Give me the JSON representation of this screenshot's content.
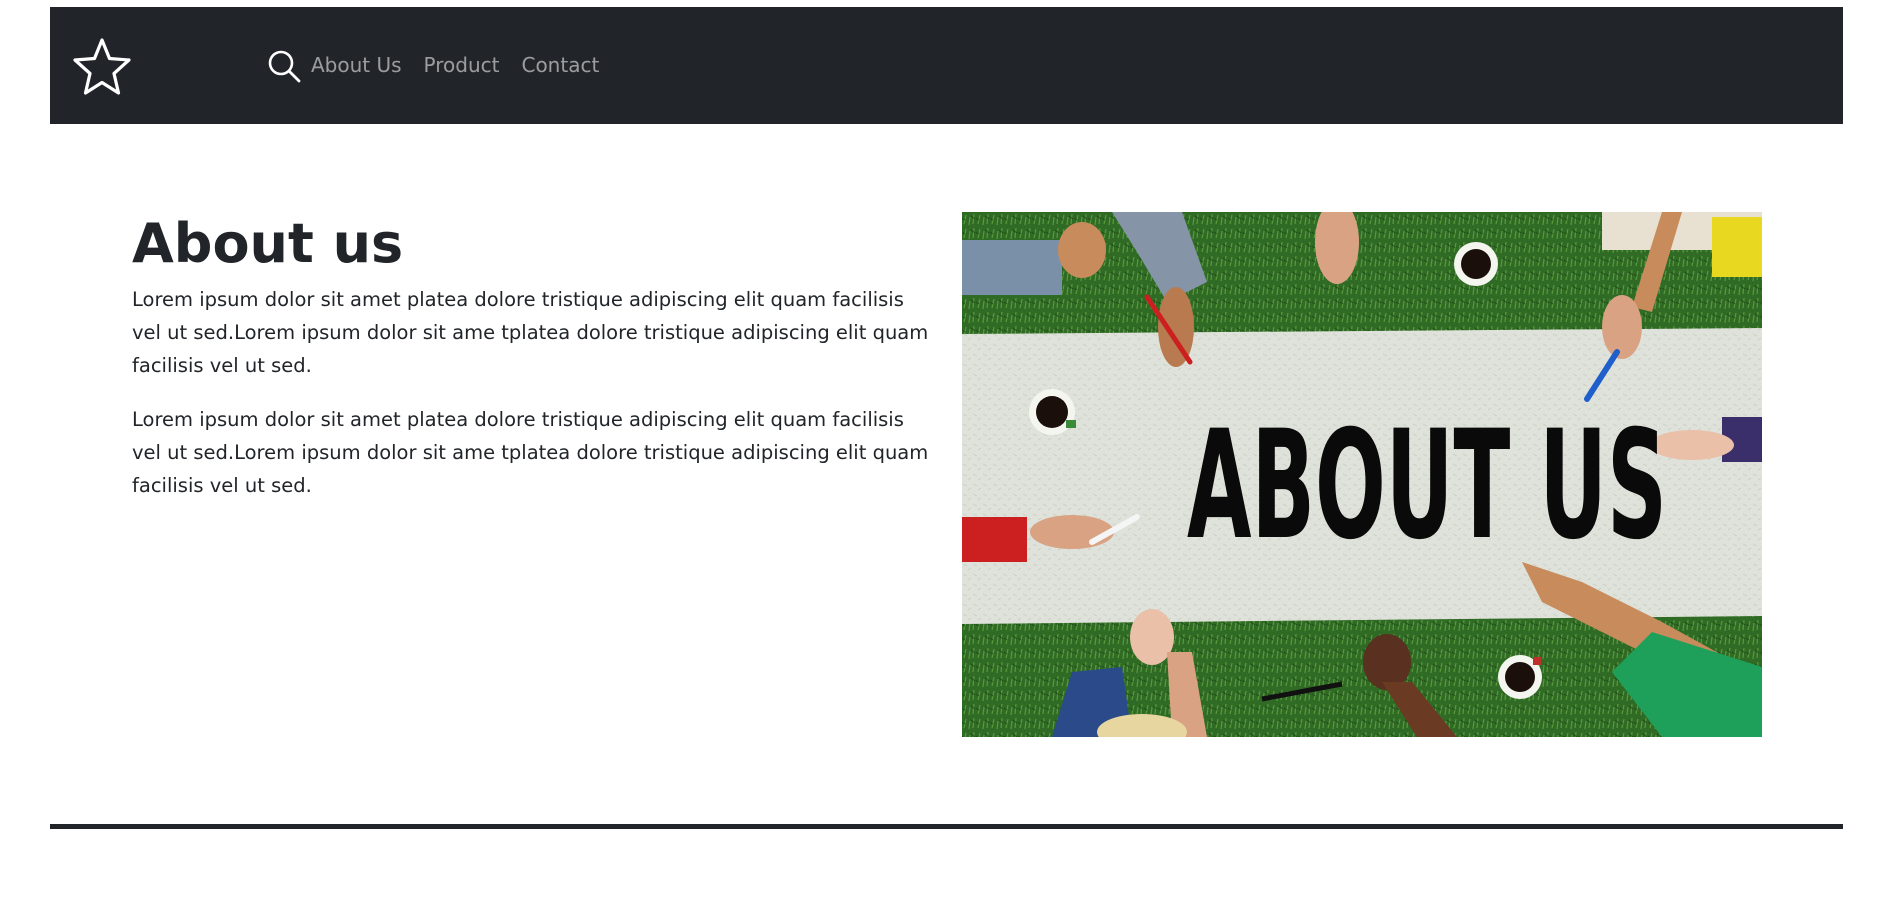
{
  "navbar": {
    "brand_icon": "star-icon",
    "search_icon": "search-icon",
    "links": [
      {
        "label": "About Us"
      },
      {
        "label": "Product"
      },
      {
        "label": "Contact"
      }
    ],
    "background_color": "#212529",
    "link_color": "rgba(255,255,255,0.55)"
  },
  "main": {
    "title": "About us",
    "paragraphs": [
      "Lorem ipsum dolor sit amet platea dolore tristique adipiscing elit quam facilisis vel ut sed.Lorem ipsum dolor sit ame tplatea dolore tristique adipiscing elit quam facilisis vel ut sed.",
      "Lorem ipsum dolor sit amet platea dolore tristique adipiscing elit quam facilisis vel ut sed.Lorem ipsum dolor sit ame tplatea dolore tristique adipiscing elit quam facilisis vel ut sed."
    ]
  },
  "hero_image": {
    "text": "ABOUT US"
  }
}
